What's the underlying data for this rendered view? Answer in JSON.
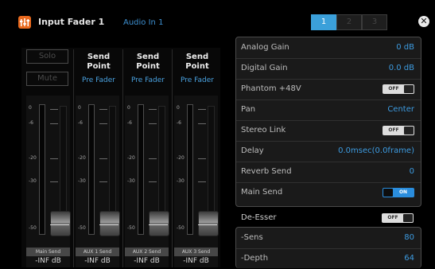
{
  "header": {
    "title": "Input Fader 1",
    "source": "Audio In 1",
    "tabs": [
      "1",
      "2",
      "3"
    ],
    "active_tab": "1",
    "close_symbol": "✕"
  },
  "left": {
    "solo_label": "Solo",
    "mute_label": "Mute",
    "scale_ticks": [
      "0",
      "-6",
      "-20",
      "-30",
      "-50"
    ],
    "channels": [
      {
        "head": "",
        "prefader": "",
        "label": "Main Send",
        "readout": "-INF dB"
      },
      {
        "head": "Send Point",
        "prefader": "Pre Fader",
        "label": "AUX 1 Send",
        "readout": "-INF dB"
      },
      {
        "head": "Send Point",
        "prefader": "Pre Fader",
        "label": "AUX 2 Send",
        "readout": "-INF dB"
      },
      {
        "head": "Send Point",
        "prefader": "Pre Fader",
        "label": "AUX 3 Send",
        "readout": "-INF dB"
      }
    ]
  },
  "params": {
    "analog_gain": {
      "label": "Analog Gain",
      "value": "0 dB"
    },
    "digital_gain": {
      "label": "Digital Gain",
      "value": "0.0 dB"
    },
    "phantom": {
      "label": "Phantom +48V",
      "state": "OFF"
    },
    "pan": {
      "label": "Pan",
      "value": "Center"
    },
    "stereo_link": {
      "label": "Stereo Link",
      "state": "OFF"
    },
    "delay": {
      "label": "Delay",
      "value": "0.0msec(0.0frame)"
    },
    "reverb_send": {
      "label": "Reverb Send",
      "value": "0"
    },
    "main_send": {
      "label": "Main Send",
      "state": "ON"
    }
  },
  "deesser": {
    "label": "De-Esser",
    "state": "OFF",
    "sens": {
      "label": "-Sens",
      "value": "80"
    },
    "depth": {
      "label": "-Depth",
      "value": "64"
    }
  },
  "colors": {
    "accent": "#3ba0da",
    "value_blue": "#3d9be0",
    "app_icon": "#e8691e"
  },
  "icons": {
    "app": "mixer-fader-icon",
    "close": "close-icon"
  }
}
